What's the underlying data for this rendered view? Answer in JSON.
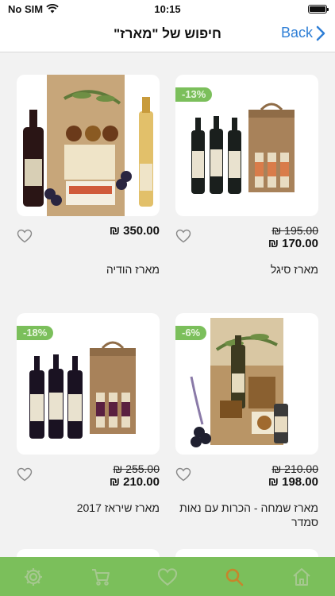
{
  "status": {
    "carrier": "No SIM",
    "time": "10:15",
    "battery_level": 1.0
  },
  "nav": {
    "title": "חיפוש של \"מארז\"",
    "back_label": "Back"
  },
  "products": [
    {
      "name": "מארז סיגל",
      "old_price": "₪ 195.00",
      "price": "₪ 170.00",
      "badge": "-13%",
      "image": "wine-gift-box-three-bottles"
    },
    {
      "name": "מארז הודיה",
      "price": "₪ 350.00",
      "image": "gift-basket-wine-olive-oil"
    },
    {
      "name": "מארז שמחה - הכרות עם נאות סמדר",
      "old_price": "₪ 210.00",
      "price": "₪ 198.00",
      "badge": "-6%",
      "image": "gift-box-olive-oil-snacks"
    },
    {
      "name": "מארז שיראז 2017",
      "old_price": "₪ 255.00",
      "price": "₪ 210.00",
      "badge": "-18%",
      "image": "wine-gift-box-three-bottles"
    }
  ],
  "tabs": [
    {
      "name": "settings",
      "icon": "gear-icon"
    },
    {
      "name": "cart",
      "icon": "cart-icon"
    },
    {
      "name": "favorites",
      "icon": "heart-icon"
    },
    {
      "name": "search",
      "icon": "search-icon",
      "active": true
    },
    {
      "name": "home",
      "icon": "home-icon"
    }
  ],
  "colors": {
    "accent": "#7bbf5b",
    "link": "#2f7fd6",
    "active_tab": "#c6862b",
    "inactive_tab": "#a5c88f"
  }
}
